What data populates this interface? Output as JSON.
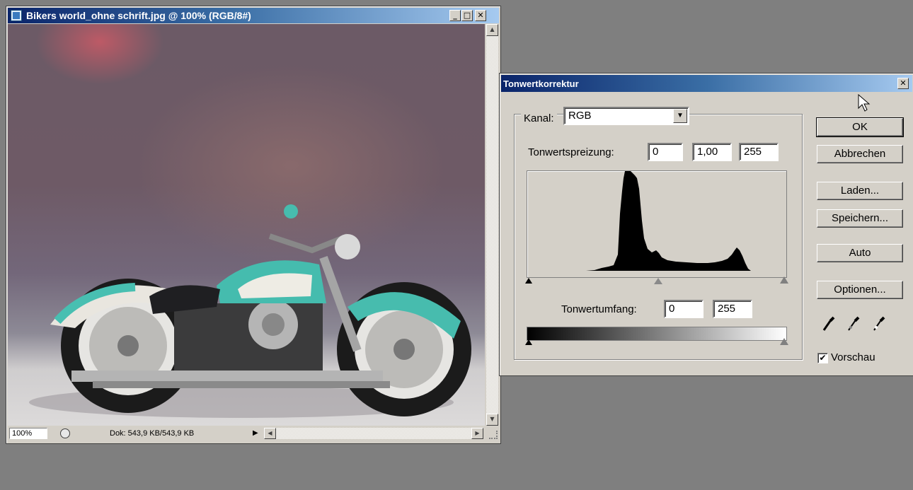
{
  "document_window": {
    "title": "Bikers world_ohne schrift.jpg @ 100% (RGB/8#)",
    "zoom": "100%",
    "doc_info": "Dok: 543,9 KB/543,9 KB",
    "min_glyph": "_",
    "max_glyph": "□",
    "close_glyph": "✕"
  },
  "levels_dialog": {
    "title": "Tonwertkorrektur",
    "close_glyph": "✕",
    "channel_label": "Kanal:",
    "channel_value": "RGB",
    "input_levels_label": "Tonwertspreizung:",
    "input_black": "0",
    "input_gamma": "1,00",
    "input_white": "255",
    "output_levels_label": "Tonwertumfang:",
    "output_black": "0",
    "output_white": "255",
    "buttons": {
      "ok": "OK",
      "cancel": "Abbrechen",
      "load": "Laden...",
      "save": "Speichern...",
      "auto": "Auto",
      "options": "Optionen..."
    },
    "preview_label": "Vorschau",
    "preview_checked": true
  },
  "colors": {
    "title_active": "#0a246a",
    "face": "#d4d0c8",
    "desktop": "#7f7f7f"
  }
}
